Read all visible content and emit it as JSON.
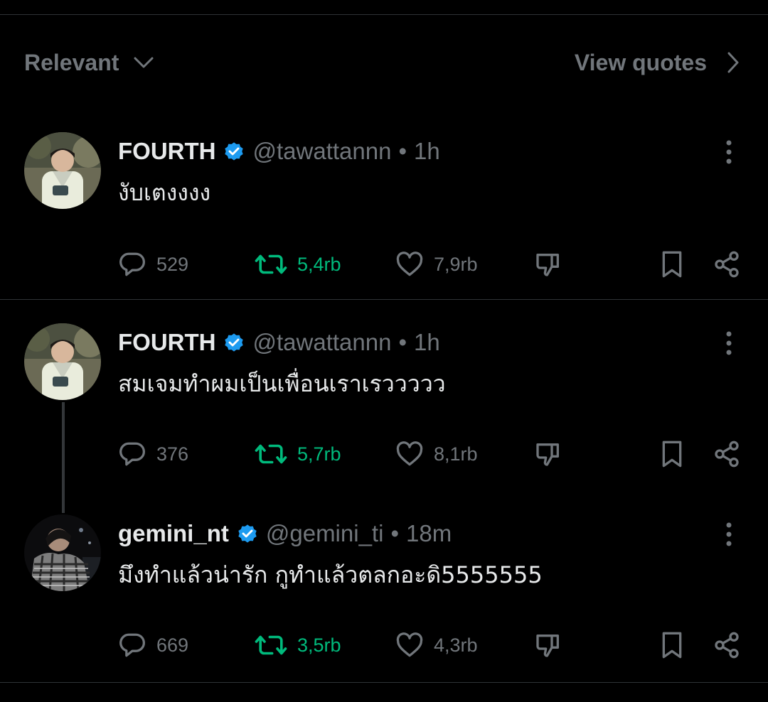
{
  "sort": {
    "label": "Relevant",
    "icon": "chevron-down-icon"
  },
  "view_quotes": {
    "label": "View quotes",
    "icon": "chevron-right-icon"
  },
  "colors": {
    "background": "#000000",
    "text": "#e7e9ea",
    "muted": "#71767b",
    "verified": "#1d9bf0",
    "retweet": "#00ba7c",
    "divider": "#2f3336"
  },
  "tweets": [
    {
      "name": "FOURTH",
      "handle": "@tawattannn",
      "separator": "•",
      "time": "1h",
      "text": "งับเตงงงง",
      "replies": "529",
      "retweets": "5,4rb",
      "likes": "7,9rb"
    },
    {
      "name": "FOURTH",
      "handle": "@tawattannn",
      "separator": "•",
      "time": "1h",
      "text": "สมเจมทำผมเป็นเพื่อนเราเรววววว",
      "replies": "376",
      "retweets": "5,7rb",
      "likes": "8,1rb"
    },
    {
      "name": "gemini_nt",
      "handle": "@gemini_ti",
      "separator": "•",
      "time": "18m",
      "text": "มึงทำแล้วน่ารัก กูทำแล้วตลกอะดิ5555555",
      "replies": "669",
      "retweets": "3,5rb",
      "likes": "4,3rb"
    }
  ]
}
